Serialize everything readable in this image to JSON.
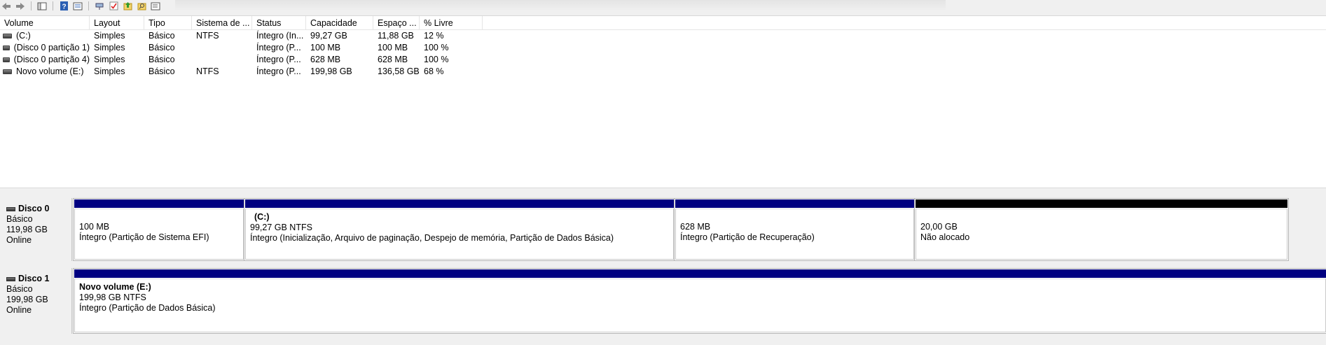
{
  "toolbar": {
    "buttons": [
      {
        "name": "back-icon",
        "glyph": "◀"
      },
      {
        "name": "forward-icon",
        "glyph": "▶"
      },
      {
        "name": "console-tree-icon",
        "glyph": "▦"
      },
      {
        "name": "help-icon",
        "glyph": "?"
      },
      {
        "name": "properties-icon",
        "glyph": "▤"
      },
      {
        "name": "connect-icon",
        "glyph": "⊶"
      },
      {
        "name": "check-icon",
        "glyph": "✓"
      },
      {
        "name": "up-arrow-icon",
        "glyph": "↑"
      },
      {
        "name": "search-icon",
        "glyph": "⌕"
      },
      {
        "name": "view-icon",
        "glyph": "▭"
      }
    ]
  },
  "list": {
    "headers": [
      "Volume",
      "Layout",
      "Tipo",
      "Sistema de ...",
      "Status",
      "Capacidade",
      "Espaço ...",
      "% Livre"
    ],
    "rows": [
      {
        "volume": " (C:)",
        "layout": "Simples",
        "tipo": "Básico",
        "fs": "NTFS",
        "status": "Íntegro (In...",
        "cap": "99,27 GB",
        "free": "11,88 GB",
        "pct": "12 %"
      },
      {
        "volume": "(Disco 0 partição 1)",
        "layout": "Simples",
        "tipo": "Básico",
        "fs": "",
        "status": "Íntegro (P...",
        "cap": "100 MB",
        "free": "100 MB",
        "pct": "100 %"
      },
      {
        "volume": "(Disco 0 partição 4)",
        "layout": "Simples",
        "tipo": "Básico",
        "fs": "",
        "status": "Íntegro (P...",
        "cap": "628 MB",
        "free": "628 MB",
        "pct": "100 %"
      },
      {
        "volume": "Novo volume (E:)",
        "layout": "Simples",
        "tipo": "Básico",
        "fs": "NTFS",
        "status": "Íntegro (P...",
        "cap": "199,98 GB",
        "free": "136,58 GB",
        "pct": "68 %"
      }
    ]
  },
  "disks": [
    {
      "name": "Disco 0",
      "type": "Básico",
      "size": "119,98 GB",
      "state": "Online",
      "partitions": [
        {
          "title": "",
          "size": "100 MB",
          "status": "Íntegro (Partição de Sistema EFI)",
          "bar": "primary"
        },
        {
          "title": "(C:)",
          "size": "99,27 GB NTFS",
          "status": "Íntegro (Inicialização, Arquivo de paginação, Despejo de memória, Partição de Dados Básica)",
          "bar": "primary"
        },
        {
          "title": "",
          "size": "628 MB",
          "status": "Íntegro (Partição de Recuperação)",
          "bar": "primary"
        },
        {
          "title": "",
          "size": "20,00 GB",
          "status": "Não alocado",
          "bar": "unallocated"
        }
      ]
    },
    {
      "name": "Disco 1",
      "type": "Básico",
      "size": "199,98 GB",
      "state": "Online",
      "partitions": [
        {
          "title": "Novo volume  (E:)",
          "size": "199,98 GB NTFS",
          "status": "Íntegro (Partição de Dados Básica)",
          "bar": "primary"
        }
      ]
    }
  ],
  "colors": {
    "primary_bar": "#000080",
    "unallocated_bar": "#000000"
  }
}
